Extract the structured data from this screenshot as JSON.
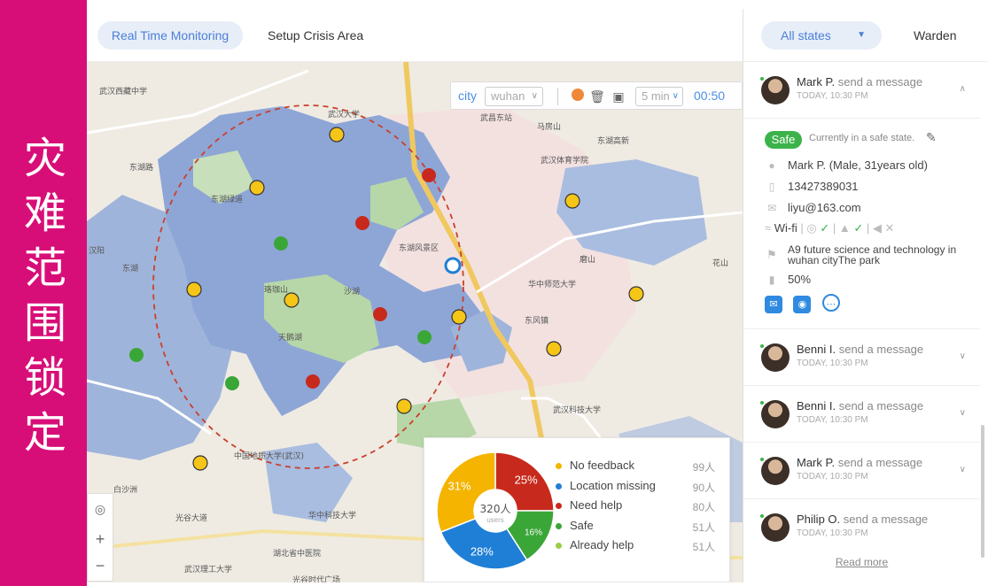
{
  "side_title": "灾难范围锁定",
  "tabs": {
    "monitoring": "Real Time Monitoring",
    "setup": "Setup Crisis Area"
  },
  "map_toolbar": {
    "city_label": "city",
    "city_value": "wuhan",
    "interval": "5 min",
    "timer": "00:50"
  },
  "map_labels": [
    "武汉西藏中学",
    "武汉大学",
    "武昌东站",
    "东湖路",
    "东湖绿道",
    "东湖",
    "磨山",
    "汉阳",
    "东湖风景区",
    "花山",
    "白沙洲",
    "光谷大道",
    "华中科技大学",
    "武汉理工大学",
    "中国地质大学(武汉)",
    "湖北省中医院",
    "光谷时代广场",
    "马房山",
    "东湖高新",
    "武汉体育学院",
    "沙湖",
    "天鹅湖",
    "东风镇",
    "武汉科技大学",
    "华中师范大学",
    "珞珈山"
  ],
  "stats": {
    "total": "320人",
    "total_sub": "users",
    "slices": [
      {
        "label": "No feedback",
        "count": "99人",
        "percent": "31%",
        "color": "#f5b400",
        "value": 99
      },
      {
        "label": "Location missing",
        "count": "90人",
        "percent": "28%",
        "color": "#1f7fd6",
        "value": 90
      },
      {
        "label": "Need help",
        "count": "80人",
        "percent": "25%",
        "color": "#c72a1c",
        "value": 80
      },
      {
        "label": "Safe",
        "count": "51人",
        "percent": "16%",
        "color": "#3aa637",
        "value": 51
      },
      {
        "label": "Already help",
        "count": "51人",
        "percent": "",
        "color": "#9ccc4a",
        "value": 0
      }
    ]
  },
  "panel": {
    "state_filter": "All states",
    "role": "Warden",
    "messages": [
      {
        "name": "Mark P.",
        "action": "send a message",
        "time": "TODAY, 10:30 PM"
      },
      {
        "name": "Benni I.",
        "action": "send a message",
        "time": "TODAY, 10:30 PM"
      },
      {
        "name": "Benni I.",
        "action": "send a message",
        "time": "TODAY, 10:30 PM"
      },
      {
        "name": "Mark P.",
        "action": "send a message",
        "time": "TODAY, 10:30 PM"
      },
      {
        "name": "Philip O.",
        "action": "send a message",
        "time": "TODAY, 10:30 PM"
      }
    ],
    "detail": {
      "status": "Safe",
      "status_text": "Currently in a safe state.",
      "person": "Mark P.  (Male, 31years old)",
      "phone": "13427389031",
      "email": "liyu@163.com",
      "wifi": "Wi-fi",
      "address": "A9 future science and technology in wuhan cityThe park",
      "battery": "50%"
    },
    "read_more": "Read more"
  }
}
